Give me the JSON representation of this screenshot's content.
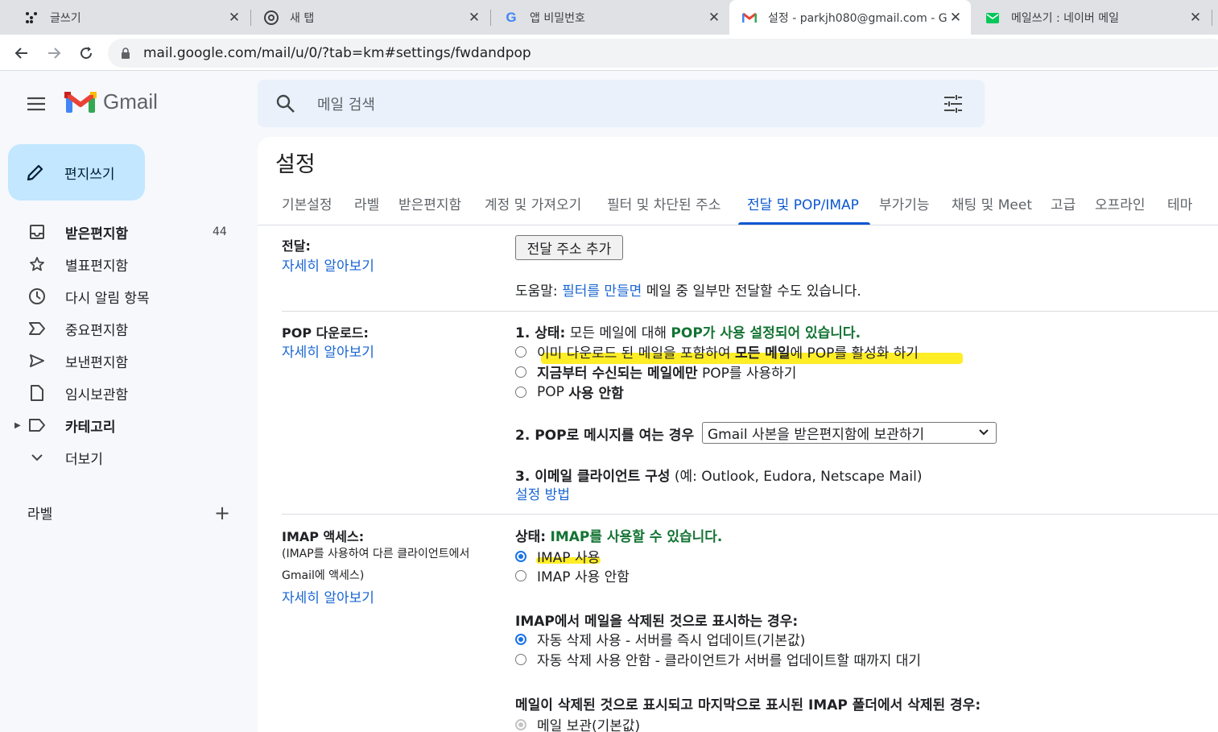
{
  "browser": {
    "tabs": [
      {
        "title": "글쓰기",
        "favicon": "dots-icon"
      },
      {
        "title": "새 탭",
        "favicon": "chrome-icon"
      },
      {
        "title": "앱 비밀번호",
        "favicon": "google-g-icon"
      },
      {
        "title": "설정 - parkjh080@gmail.com - G",
        "favicon": "gmail-icon"
      },
      {
        "title": "메일쓰기 : 네이버 메일",
        "favicon": "naver-mail-icon"
      }
    ],
    "url": "mail.google.com/mail/u/0/?tab=km#settings/fwdandpop"
  },
  "gmail": {
    "logo_text": "Gmail",
    "search_placeholder": "메일 검색",
    "compose_label": "편지쓰기",
    "nav": [
      {
        "label": "받은편지함",
        "count": "44",
        "icon": "inbox-icon",
        "bold": true
      },
      {
        "label": "별표편지함",
        "icon": "star-icon"
      },
      {
        "label": "다시 알림 항목",
        "icon": "clock-icon"
      },
      {
        "label": "중요편지함",
        "icon": "important-icon"
      },
      {
        "label": "보낸편지함",
        "icon": "send-icon"
      },
      {
        "label": "임시보관함",
        "icon": "draft-icon"
      },
      {
        "label": "카테고리",
        "icon": "label-icon",
        "bold": true
      },
      {
        "label": "더보기",
        "icon": "chevron-down-icon"
      }
    ],
    "labels_heading": "라벨"
  },
  "settings": {
    "title": "설정",
    "tabs": [
      "기본설정",
      "라벨",
      "받은편지함",
      "계정 및 가져오기",
      "필터 및 차단된 주소",
      "전달 및 POP/IMAP",
      "부가기능",
      "채팅 및 Meet",
      "고급",
      "오프라인",
      "테마"
    ],
    "active_tab": "전달 및 POP/IMAP",
    "forwarding": {
      "label": "전달:",
      "learn_more": "자세히 알아보기",
      "add_button": "전달 주소 추가",
      "tip_prefix": "도움말:",
      "tip_link": "필터를 만들면",
      "tip_suffix": "메일 중 일부만 전달할 수도 있습니다."
    },
    "pop": {
      "label": "POP 다운로드:",
      "learn_more": "자세히 알아보기",
      "status_prefix": "1. 상태:",
      "status_mid": "모든 메일에 대해",
      "status_green": "POP가 사용 설정되어 있습니다.",
      "options": [
        {
          "pre": "이미 다운로드 된 메일을 포함하여",
          "bold": "모든 메일",
          "post": "에 POP를 활성화 하기",
          "checked": false
        },
        {
          "pre": "",
          "bold": "지금부터 수신되는 메일에만",
          "post": "POP를 사용하기",
          "checked": false
        },
        {
          "pre": "POP",
          "bold": "사용 안함",
          "post": "",
          "checked": false
        }
      ],
      "when_label": "2. POP로 메시지를 여는 경우",
      "when_value": "Gmail 사본을 받은편지함에 보관하기",
      "client_label": "3. 이메일 클라이언트 구성",
      "client_example": "(예: Outlook, Eudora, Netscape Mail)",
      "client_link": "설정 방법"
    },
    "imap": {
      "label": "IMAP 액세스:",
      "sub1": "(IMAP를 사용하여 다른 클라이언트에서",
      "sub2": "Gmail에 액세스)",
      "learn_more": "자세히 알아보기",
      "status_prefix": "상태:",
      "status_green": "IMAP를 사용할 수 있습니다.",
      "options": [
        {
          "label": "IMAP 사용",
          "checked": true
        },
        {
          "label": "IMAP 사용 안함",
          "checked": false
        }
      ],
      "delete_heading": "IMAP에서 메일을 삭제된 것으로 표시하는 경우:",
      "delete_options": [
        {
          "label": "자동 삭제 사용 - 서버를 즉시 업데이트(기본값)",
          "checked": true
        },
        {
          "label": "자동 삭제 사용 안함 - 클라이언트가 서버를 업데이트할 때까지 대기",
          "checked": false
        }
      ],
      "expunge_heading": "메일이 삭제된 것으로 표시되고 마지막으로 표시된 IMAP 폴더에서 삭제된 경우:",
      "expunge_options": [
        {
          "label": "메일 보관(기본값)",
          "checked": true
        }
      ]
    }
  },
  "colors": {
    "accent": "#0b57d0",
    "green": "#137333",
    "highlight": "#ffeb00",
    "compose": "#c2e7ff"
  }
}
